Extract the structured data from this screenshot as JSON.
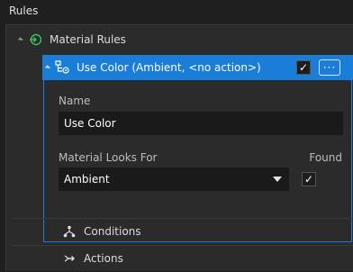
{
  "panel": {
    "title": "Rules"
  },
  "tree": {
    "material_rules": {
      "label": "Material Rules"
    },
    "rule": {
      "label": "Use Color (Ambient, <no action>)",
      "enabled_mark": "✓",
      "menu_label": "···"
    },
    "details": {
      "name_label": "Name",
      "name_value": "Use Color",
      "looks_for_label": "Material Looks For",
      "looks_for_value": "Ambient",
      "found_label": "Found",
      "found_mark": "✓"
    },
    "conditions": {
      "label": "Conditions"
    },
    "actions": {
      "label": "Actions"
    }
  },
  "colors": {
    "accent": "#1a7dd7",
    "background": "#1f1f1f",
    "panel": "#2b2b2b",
    "field": "#1a1a1a"
  }
}
